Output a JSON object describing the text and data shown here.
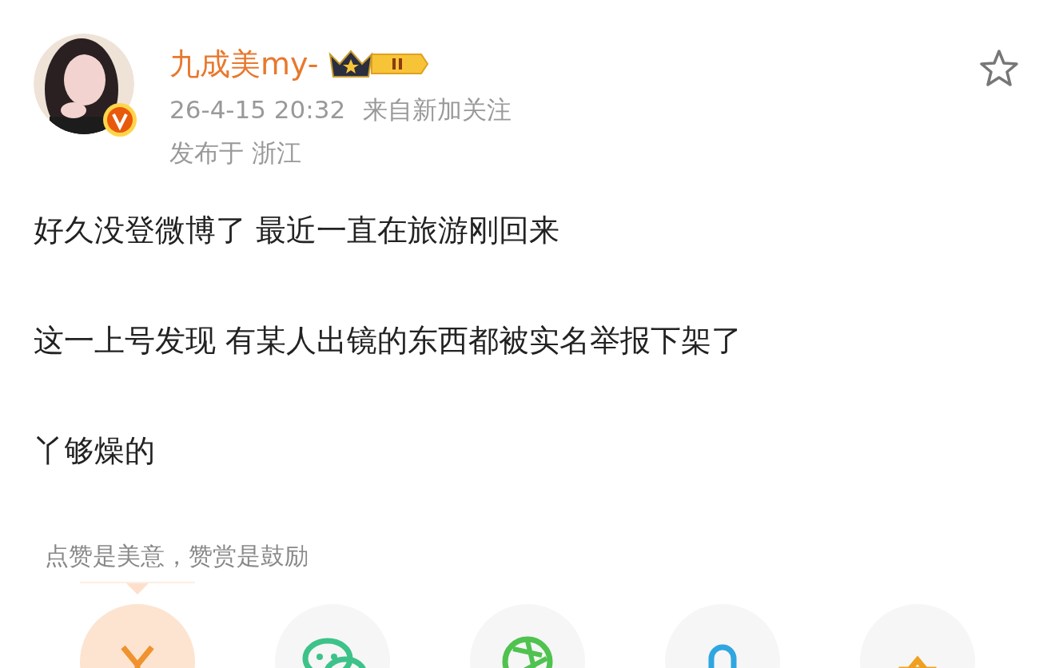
{
  "post": {
    "author": {
      "name": "九成美my-",
      "verified": true
    },
    "time": "26-4-15 20:32",
    "source": "来自新加关注",
    "location": "发布于 浙江",
    "favorited": false,
    "paragraphs": [
      "好久没登微博了 最近一直在旅游刚回来",
      "这一上号发现 有某人出镜的东西都被实名举报下架了",
      "丫够燥的"
    ]
  },
  "reward": {
    "hint": "点赞是美意，赞赏是鼓励",
    "options": [
      {
        "kind": "yuan",
        "selected": true
      },
      {
        "kind": "wechat",
        "selected": false
      },
      {
        "kind": "aperture",
        "selected": false
      },
      {
        "kind": "pin",
        "selected": false
      },
      {
        "kind": "box",
        "selected": false
      }
    ]
  }
}
